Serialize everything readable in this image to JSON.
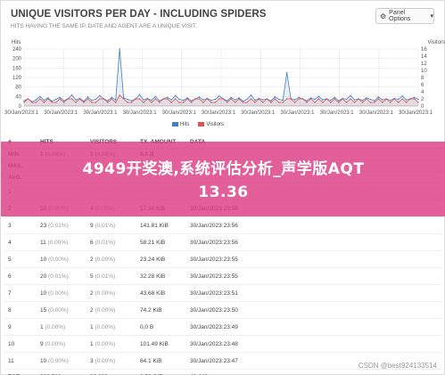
{
  "panel": {
    "title": "UNIQUE VISITORS PER DAY - INCLUDING SPIDERS",
    "subtitle": "HITS HAVING THE SAME IP, DATE AND AGENT ARE A UNIQUE VISIT.",
    "options_label": "Panel Options",
    "options_icon": "gear-icon"
  },
  "chart_data": {
    "type": "line",
    "ylabel_left": "Hits",
    "ylabel_right": "Visitors",
    "left_ticks": [
      "240",
      "200",
      "160",
      "120",
      "80",
      "40",
      "0"
    ],
    "right_ticks": [
      "16",
      "14",
      "12",
      "10",
      "8",
      "6",
      "4",
      "2",
      "0"
    ],
    "ylim_left": [
      0,
      240
    ],
    "ylim_right": [
      0,
      16
    ],
    "x_tick_labels": [
      "30/Jan/2023:1",
      "30/Jan/2023:1",
      "30/Jan/2023:1",
      "30/Jan/2023:1",
      "30/Jan/2023:1",
      "30/Jan/2023:1",
      "30/Jan/2023:1",
      "30/Jan/2023:1",
      "30/Jan/2023:1",
      "30/Jan/2023:1",
      "30/Jan/2023:1"
    ],
    "grid": true,
    "legend_position": "bottom-center",
    "series": [
      {
        "name": "Hits",
        "color": "#447fc1",
        "axis": "left",
        "values": [
          22,
          30,
          18,
          26,
          40,
          24,
          34,
          20,
          28,
          36,
          22,
          30,
          46,
          26,
          32,
          20,
          38,
          24,
          28,
          44,
          30,
          22,
          36,
          26,
          240,
          34,
          28,
          22,
          30,
          48,
          26,
          32,
          24,
          40,
          22,
          30,
          36,
          26,
          44,
          28,
          24,
          34,
          22,
          30,
          38,
          26,
          32,
          24,
          28,
          42,
          30,
          22,
          36,
          26,
          34,
          20,
          28,
          46,
          24,
          32,
          26,
          30,
          22,
          38,
          28,
          24,
          140,
          32,
          26,
          36,
          30,
          22,
          34,
          28,
          40,
          26,
          30,
          24,
          36,
          22,
          32,
          28,
          44,
          26,
          30,
          24,
          34,
          28,
          22,
          38,
          26,
          30,
          24,
          32,
          28,
          42,
          26,
          30,
          36,
          28
        ]
      },
      {
        "name": "Visitors",
        "color": "#d9534f",
        "axis": "right",
        "values": [
          1,
          2,
          1,
          1,
          2,
          1,
          2,
          1,
          1,
          2,
          1,
          2,
          2,
          1,
          2,
          1,
          2,
          1,
          1,
          2,
          2,
          1,
          2,
          1,
          3,
          2,
          1,
          1,
          2,
          2,
          1,
          2,
          1,
          2,
          1,
          2,
          2,
          1,
          2,
          1,
          1,
          2,
          1,
          2,
          2,
          1,
          2,
          1,
          1,
          2,
          2,
          1,
          2,
          1,
          2,
          1,
          1,
          2,
          1,
          2,
          1,
          2,
          1,
          2,
          1,
          1,
          2,
          2,
          1,
          2,
          2,
          1,
          2,
          1,
          2,
          1,
          2,
          1,
          2,
          1,
          2,
          1,
          2,
          1,
          2,
          1,
          2,
          1,
          1,
          2,
          1,
          2,
          1,
          2,
          1,
          2,
          1,
          2,
          2,
          1
        ]
      }
    ]
  },
  "table": {
    "headers": {
      "num": "#",
      "hits": "HITS",
      "visitors": "VISITORS",
      "tx": "TX. AMOUNT",
      "data": "DATA"
    },
    "summary": [
      {
        "label": "MIN.",
        "hits": "1",
        "hits_pct": "(0.00%)",
        "visitors": "1",
        "visitors_pct": "(0.00%)",
        "tx": "0.0",
        "tx_unit": "B"
      },
      {
        "label": "MAX.",
        "hits": "",
        "hits_pct": "",
        "visitors": "",
        "visitors_pct": "",
        "tx": "",
        "tx_unit": ""
      },
      {
        "label": "AVG.",
        "hits": "",
        "hits_pct": "",
        "visitors": "",
        "visitors_pct": "",
        "tx": "",
        "tx_unit": ""
      }
    ],
    "rows": [
      {
        "num": "1",
        "hits": "",
        "hits_pct": "",
        "visitors": "",
        "visitors_pct": "",
        "tx": "",
        "data": ""
      },
      {
        "num": "2",
        "hits": "10",
        "hits_pct": "(0.00%)",
        "visitors": "4",
        "visitors_pct": "(0.00%)",
        "tx": "17.34 KiB",
        "data": "30/Jan/2023:23:56"
      },
      {
        "num": "3",
        "hits": "23",
        "hits_pct": "(0.01%)",
        "visitors": "9",
        "visitors_pct": "(0.01%)",
        "tx": "141.81 KiB",
        "data": "30/Jan/2023:23:56"
      },
      {
        "num": "4",
        "hits": "11",
        "hits_pct": "(0.00%)",
        "visitors": "6",
        "visitors_pct": "(0.01%)",
        "tx": "58.21 KiB",
        "data": "30/Jan/2023:23:56"
      },
      {
        "num": "5",
        "hits": "10",
        "hits_pct": "(0.00%)",
        "visitors": "2",
        "visitors_pct": "(0.00%)",
        "tx": "23.24 KiB",
        "data": "30/Jan/2023:23:55"
      },
      {
        "num": "6",
        "hits": "20",
        "hits_pct": "(0.01%)",
        "visitors": "5",
        "visitors_pct": "(0.01%)",
        "tx": "32.28 KiB",
        "data": "30/Jan/2023:23:55"
      },
      {
        "num": "7",
        "hits": "10",
        "hits_pct": "(0.00%)",
        "visitors": "2",
        "visitors_pct": "(0.00%)",
        "tx": "43.68 KiB",
        "data": "30/Jan/2023:23:51"
      },
      {
        "num": "8",
        "hits": "15",
        "hits_pct": "(0.00%)",
        "visitors": "2",
        "visitors_pct": "(0.00%)",
        "tx": "74.2 KiB",
        "data": "30/Jan/2023:23:50"
      },
      {
        "num": "9",
        "hits": "1",
        "hits_pct": "(0.00%)",
        "visitors": "1",
        "visitors_pct": "(0.00%)",
        "tx": "0.0 B",
        "data": "30/Jan/2023:23:49"
      },
      {
        "num": "10",
        "hits": "9",
        "hits_pct": "(0.00%)",
        "visitors": "1",
        "visitors_pct": "(0.00%)",
        "tx": "101.49 KiB",
        "data": "30/Jan/2023:23:48"
      },
      {
        "num": "11",
        "hits": "10",
        "hits_pct": "(0.00%)",
        "visitors": "3",
        "visitors_pct": "(0.00%)",
        "tx": "64.1 KiB",
        "data": "30/Jan/2023:23:47"
      }
    ],
    "total": {
      "label": "TOT.",
      "hits": "309,519",
      "visitors": "98,003",
      "tx": "2.56 GiB",
      "data": "42,449"
    }
  },
  "banner": {
    "line1": "4949开奖澳,系统评估分析_声学版AQT",
    "line2": "13.36"
  },
  "watermark": "CSDN @best924133514"
}
